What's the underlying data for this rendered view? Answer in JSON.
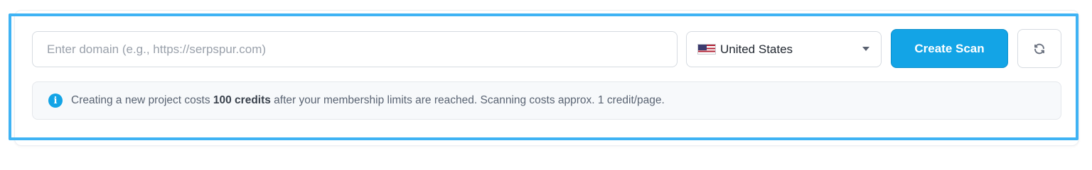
{
  "scan_form": {
    "domain_placeholder": "Enter domain (e.g., https://serpspur.com)",
    "domain_value": "",
    "country": {
      "selected": "United States",
      "flag_icon": "us-flag-icon"
    },
    "create_label": "Create Scan",
    "refresh_icon": "refresh-icon"
  },
  "notice": {
    "icon": "info-icon",
    "text_before": "Creating a new project costs ",
    "credits": "100 credits",
    "text_after": " after your membership limits are reached. Scanning costs approx. 1 credit/page."
  },
  "colors": {
    "accent": "#13a4e6",
    "focus_ring": "#3fb3f4"
  }
}
